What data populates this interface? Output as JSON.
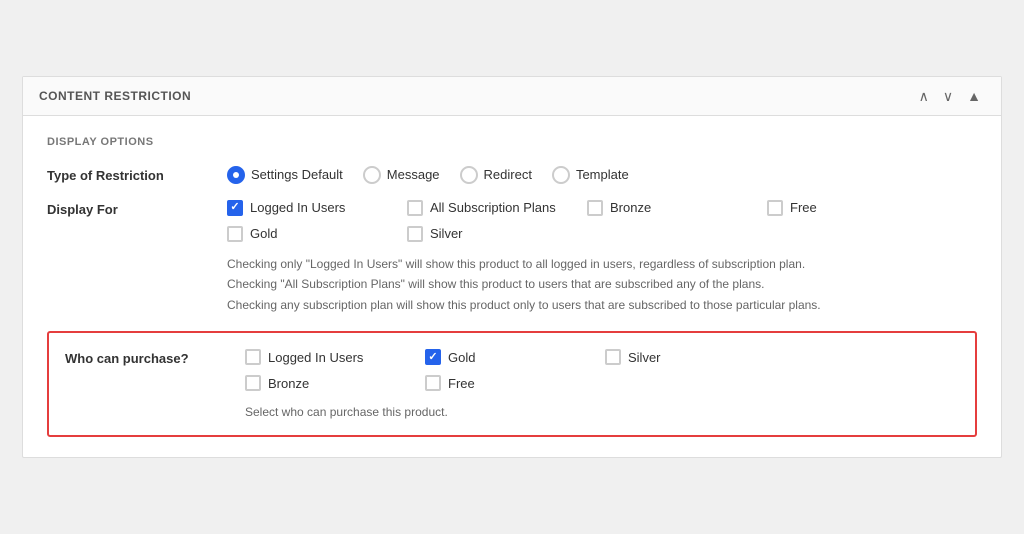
{
  "panel": {
    "title": "CONTENT RESTRICTION",
    "controls": {
      "up": "▲",
      "down": "▼",
      "collapse": "▲"
    }
  },
  "display_options": {
    "section_label": "DISPLAY OPTIONS",
    "type_of_restriction": {
      "label": "Type of Restriction",
      "options": [
        {
          "id": "settings-default",
          "label": "Settings Default",
          "checked": true
        },
        {
          "id": "message",
          "label": "Message",
          "checked": false
        },
        {
          "id": "redirect",
          "label": "Redirect",
          "checked": false
        },
        {
          "id": "template",
          "label": "Template",
          "checked": false
        }
      ]
    },
    "display_for": {
      "label": "Display For",
      "options": [
        {
          "id": "logged-in-users",
          "label": "Logged In Users",
          "checked": true
        },
        {
          "id": "all-subscription-plans",
          "label": "All Subscription Plans",
          "checked": false
        },
        {
          "id": "bronze",
          "label": "Bronze",
          "checked": false
        },
        {
          "id": "free",
          "label": "Free",
          "checked": false
        },
        {
          "id": "gold",
          "label": "Gold",
          "checked": false
        },
        {
          "id": "silver",
          "label": "Silver",
          "checked": false
        }
      ],
      "hints": [
        "Checking only \"Logged In Users\" will show this product to all logged in users, regardless of subscription plan.",
        "Checking \"All Subscription Plans\" will show this product to users that are subscribed any of the plans.",
        "Checking any subscription plan will show this product only to users that are subscribed to those particular plans."
      ]
    }
  },
  "who_can_purchase": {
    "label": "Who can purchase?",
    "options": [
      {
        "id": "wcp-logged-in-users",
        "label": "Logged In Users",
        "checked": false
      },
      {
        "id": "wcp-gold",
        "label": "Gold",
        "checked": true
      },
      {
        "id": "wcp-silver",
        "label": "Silver",
        "checked": false
      },
      {
        "id": "wcp-bronze",
        "label": "Bronze",
        "checked": false
      },
      {
        "id": "wcp-free",
        "label": "Free",
        "checked": false
      }
    ],
    "hint": "Select who can purchase this product."
  }
}
